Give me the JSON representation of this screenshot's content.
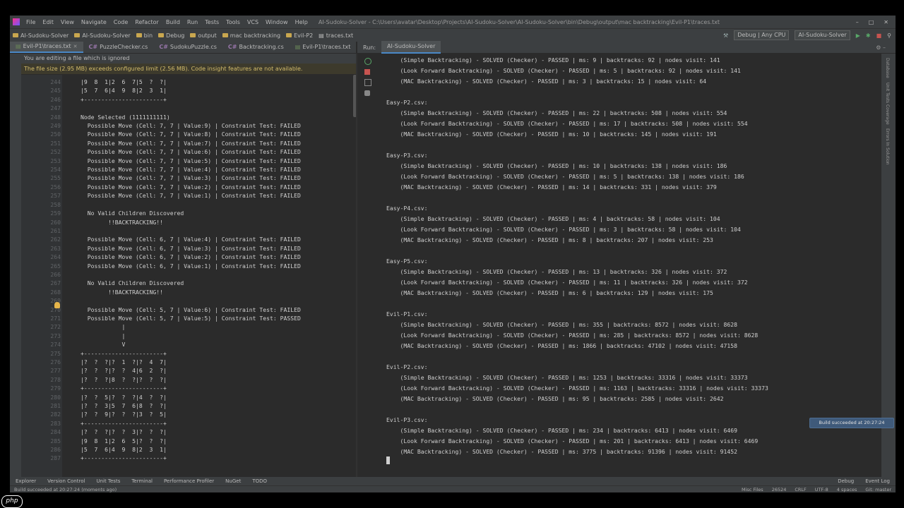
{
  "window": {
    "menu": [
      "File",
      "Edit",
      "View",
      "Navigate",
      "Code",
      "Refactor",
      "Build",
      "Run",
      "Tests",
      "Tools",
      "VCS",
      "Window",
      "Help"
    ],
    "path": "AI-Sudoku-Solver - C:\\Users\\avatar\\Desktop\\Projects\\AI-Sudoku-Solver\\AI-Sudoku-Solver\\bin\\Debug\\output\\mac backtracking\\Evil-P1\\traces.txt"
  },
  "breadcrumbs": [
    "AI-Sudoku-Solver",
    "AI-Sudoku-Solver",
    "bin",
    "Debug",
    "output",
    "mac backtracking",
    "Evil-P2",
    "traces.txt"
  ],
  "toolbar": {
    "config": "Debug | Any CPU",
    "project": "AI-Sudoku-Solver"
  },
  "tabs": [
    {
      "label": "Evil-P1\\traces.txt",
      "kind": "txt",
      "active": true
    },
    {
      "label": "PuzzleChecker.cs",
      "kind": "cs"
    },
    {
      "label": "SudokuPuzzle.cs",
      "kind": "cs"
    },
    {
      "label": "Backtracking.cs",
      "kind": "cs"
    },
    {
      "label": "Evil-P1\\traces.txt",
      "kind": "txt"
    }
  ],
  "warnings": {
    "ignored": "You are editing a file which is ignored",
    "size": "The file size (2.95 MB) exceeds configured limit (2.56 MB). Code insight features are not available."
  },
  "editor": {
    "line_numbers": [
      "244",
      "245",
      "246",
      "247",
      "248",
      "249",
      "250",
      "251",
      "252",
      "253",
      "254",
      "255",
      "256",
      "257",
      "258",
      "259",
      "260",
      "261",
      "262",
      "263",
      "264",
      "265",
      "266",
      "267",
      "268",
      "269",
      "270",
      "271",
      "272",
      "273",
      "274",
      "275",
      "276",
      "277",
      "278",
      "279",
      "280",
      "281",
      "282",
      "283",
      "284",
      "285",
      "286",
      "287"
    ],
    "text": "|9  8  1|2  6  7|5  ?  ?|\n|5  7  6|4  9  8|2  3  1|\n+-----------------------+\n\nNode Selected (1111111111)\n  Possible Move (Cell: 7, 7 | Value:9) | Constraint Test: FAILED\n  Possible Move (Cell: 7, 7 | Value:8) | Constraint Test: FAILED\n  Possible Move (Cell: 7, 7 | Value:7) | Constraint Test: FAILED\n  Possible Move (Cell: 7, 7 | Value:6) | Constraint Test: FAILED\n  Possible Move (Cell: 7, 7 | Value:5) | Constraint Test: FAILED\n  Possible Move (Cell: 7, 7 | Value:4) | Constraint Test: FAILED\n  Possible Move (Cell: 7, 7 | Value:3) | Constraint Test: FAILED\n  Possible Move (Cell: 7, 7 | Value:2) | Constraint Test: FAILED\n  Possible Move (Cell: 7, 7 | Value:1) | Constraint Test: FAILED\n\n  No Valid Children Discovered\n        !!BACKTRACKING!!\n\n  Possible Move (Cell: 6, 7 | Value:4) | Constraint Test: FAILED\n  Possible Move (Cell: 6, 7 | Value:3) | Constraint Test: FAILED\n  Possible Move (Cell: 6, 7 | Value:2) | Constraint Test: FAILED\n  Possible Move (Cell: 6, 7 | Value:1) | Constraint Test: FAILED\n\n  No Valid Children Discovered\n        !!BACKTRACKING!!\n\n  Possible Move (Cell: 5, 7 | Value:6) | Constraint Test: FAILED\n  Possible Move (Cell: 5, 7 | Value:5) | Constraint Test: PASSED\n            |\n            |\n            V\n+-----------------------+\n|?  ?  ?|?  1  ?|?  4  7|\n|?  ?  ?|?  ?  4|6  2  ?|\n|?  ?  ?|8  ?  ?|?  ?  ?|\n+-----------------------+\n|?  ?  5|?  ?  ?|4  ?  ?|\n|?  ?  3|5  7  6|8  ?  ?|\n|?  ?  9|?  ?  ?|3  ?  5|\n+-----------------------+\n|?  ?  ?|?  ?  3|?  ?  ?|\n|9  8  1|2  6  5|?  ?  ?|\n|5  7  6|4  9  8|2  3  1|\n+-----------------------+"
  },
  "run_panel": {
    "label": "Run:",
    "tab": "AI-Sudoku-Solver",
    "output": "    (Simple Backtracking) - SOLVED (Checker) - PASSED | ms: 9 | backtracks: 92 | nodes visit: 141\n    (Look Forward Backtracking) - SOLVED (Checker) - PASSED | ms: 5 | backtracks: 92 | nodes visit: 141\n    (MAC Backtracking) - SOLVED (Checker) - PASSED | ms: 3 | backtracks: 15 | nodes visit: 64\n\nEasy-P2.csv:\n    (Simple Backtracking) - SOLVED (Checker) - PASSED | ms: 22 | backtracks: 508 | nodes visit: 554\n    (Look Forward Backtracking) - SOLVED (Checker) - PASSED | ms: 17 | backtracks: 508 | nodes visit: 554\n    (MAC Backtracking) - SOLVED (Checker) - PASSED | ms: 10 | backtracks: 145 | nodes visit: 191\n\nEasy-P3.csv:\n    (Simple Backtracking) - SOLVED (Checker) - PASSED | ms: 10 | backtracks: 138 | nodes visit: 186\n    (Look Forward Backtracking) - SOLVED (Checker) - PASSED | ms: 5 | backtracks: 138 | nodes visit: 186\n    (MAC Backtracking) - SOLVED (Checker) - PASSED | ms: 14 | backtracks: 331 | nodes visit: 379\n\nEasy-P4.csv:\n    (Simple Backtracking) - SOLVED (Checker) - PASSED | ms: 4 | backtracks: 58 | nodes visit: 104\n    (Look Forward Backtracking) - SOLVED (Checker) - PASSED | ms: 3 | backtracks: 58 | nodes visit: 104\n    (MAC Backtracking) - SOLVED (Checker) - PASSED | ms: 8 | backtracks: 207 | nodes visit: 253\n\nEasy-P5.csv:\n    (Simple Backtracking) - SOLVED (Checker) - PASSED | ms: 13 | backtracks: 326 | nodes visit: 372\n    (Look Forward Backtracking) - SOLVED (Checker) - PASSED | ms: 11 | backtracks: 326 | nodes visit: 372\n    (MAC Backtracking) - SOLVED (Checker) - PASSED | ms: 6 | backtracks: 129 | nodes visit: 175\n\nEvil-P1.csv:\n    (Simple Backtracking) - SOLVED (Checker) - PASSED | ms: 355 | backtracks: 8572 | nodes visit: 8628\n    (Look Forward Backtracking) - SOLVED (Checker) - PASSED | ms: 285 | backtracks: 8572 | nodes visit: 8628\n    (MAC Backtracking) - SOLVED (Checker) - PASSED | ms: 1866 | backtracks: 47102 | nodes visit: 47158\n\nEvil-P2.csv:\n    (Simple Backtracking) - SOLVED (Checker) - PASSED | ms: 1253 | backtracks: 33316 | nodes visit: 33373\n    (Look Forward Backtracking) - SOLVED (Checker) - PASSED | ms: 1163 | backtracks: 33316 | nodes visit: 33373\n    (MAC Backtracking) - SOLVED (Checker) - PASSED | ms: 95 | backtracks: 2585 | nodes visit: 2642\n\nEvil-P3.csv:\n    (Simple Backtracking) - SOLVED (Checker) - PASSED | ms: 234 | backtracks: 6413 | nodes visit: 6469\n    (Look Forward Backtracking) - SOLVED (Checker) - PASSED | ms: 201 | backtracks: 6413 | nodes visit: 6469\n    (MAC Backtracking) - SOLVED (Checker) - PASSED | ms: 3775 | backtracks: 91396 | nodes visit: 91452"
  },
  "notification": "Build succeeded at 20:27:24",
  "right_strip": [
    "Database",
    "Unit Tests Coverage",
    "Errors In Solution",
    "Notifications"
  ],
  "bottom_tabs": [
    "Explorer",
    "Version Control",
    "Unit Tests",
    "Terminal",
    "Performance Profiler",
    "NuGet",
    "TODO"
  ],
  "bottom_right": [
    "Debug",
    "Event Log"
  ],
  "status": {
    "message": "Build succeeded at 20:27:24 (moments ago)",
    "encoding_items": [
      "Misc Files",
      "26524",
      "CRLF",
      "UTF-8",
      "4 spaces",
      "Git: master"
    ]
  },
  "brand": "php"
}
